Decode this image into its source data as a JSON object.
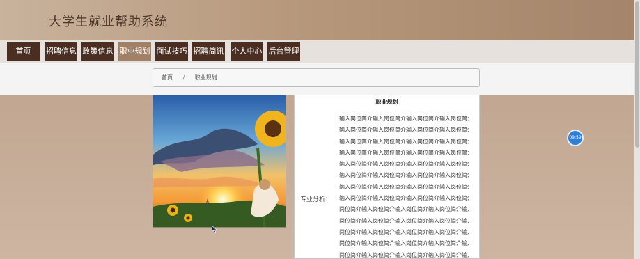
{
  "header": {
    "site_title": "大学生就业帮助系统"
  },
  "nav": {
    "items": [
      {
        "label": "首页"
      },
      {
        "label": "招聘信息"
      },
      {
        "label": "政策信息"
      },
      {
        "label": "职业规划"
      },
      {
        "label": "面试技巧"
      },
      {
        "label": "招聘简讯"
      },
      {
        "label": "个人中心"
      },
      {
        "label": "后台管理"
      }
    ],
    "active_label": "职业规划"
  },
  "breadcrumb": {
    "home": "首页",
    "separator": "/",
    "current": "职业规划"
  },
  "detail": {
    "panel_title": "职业规划",
    "field_label": "专业分析：",
    "field_lines": [
      "输入岗位简介输入岗位简介输入岗位简介输入岗位简介",
      "输入岗位简介输入岗位简介输入岗位简介输入岗位简介",
      "输入岗位简介输入岗位简介输入岗位简介输入岗位简介",
      "输入岗位简介输入岗位简介输入岗位简介输入岗位简介",
      "输入岗位简介输入岗位简介输入岗位简介输入岗位简介",
      "输入岗位简介输入岗位简介输入岗位简介输入岗位简介",
      "输入岗位简介输入岗位简介输入岗位简介输入岗位简介",
      "输入岗位简介输入岗位简介输入岗位简介输入岗位简介输入",
      "岗位简介输入岗位简介输入岗位简介输入岗位简介输入",
      "岗位简介输入岗位简介输入岗位简介输入岗位简介输入",
      "岗位简介输入岗位简介输入岗位简介输入岗位简介输入",
      "岗位简介输入岗位简介输入岗位简介输入岗位简介输入",
      "岗位简介输入岗位简介输入岗位简介输入岗位简介输入"
    ]
  },
  "timer": {
    "text": "09:59"
  },
  "colors": {
    "nav_bg": "#4a2e22",
    "nav_active_bg": "#a08066",
    "header_bg": "#b7987c",
    "timer_bg": "#2f7fd6"
  }
}
